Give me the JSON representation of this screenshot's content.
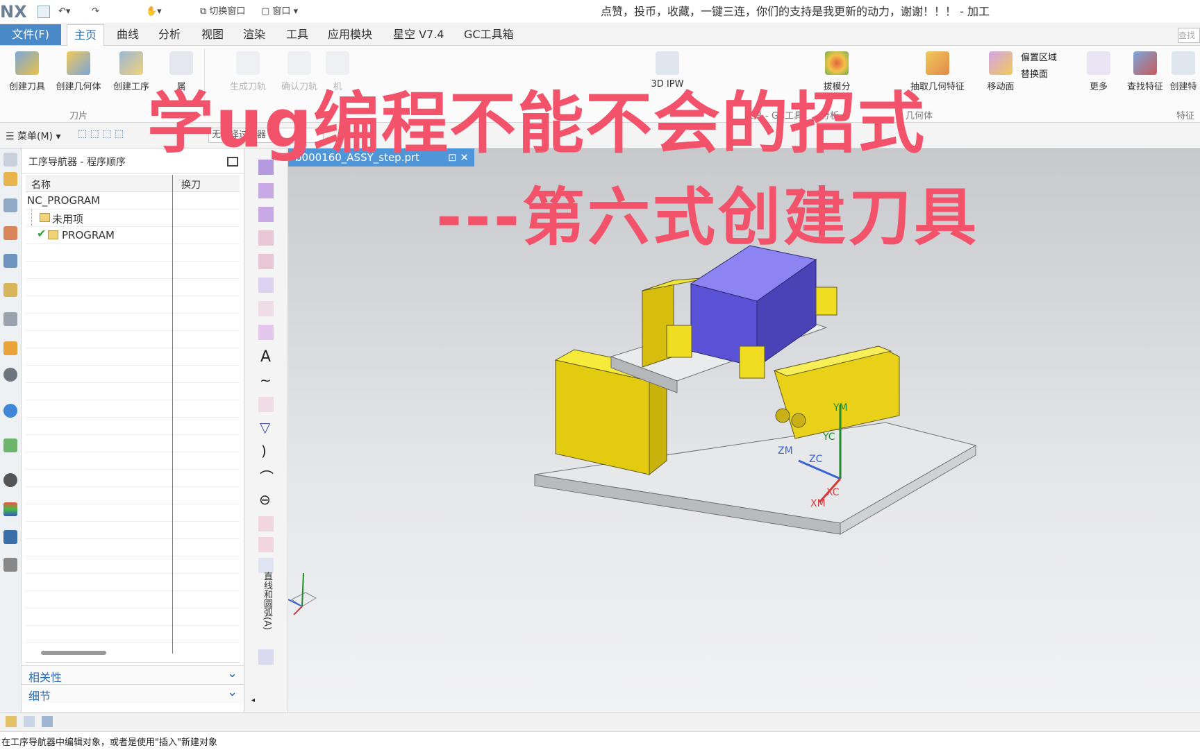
{
  "app": {
    "logo": "NX",
    "title": "点赞，投币，收藏，一键三连，你们的支持是我更新的动力，谢谢！！！ - 加工",
    "quick_access": {
      "switch_window": "切换窗口",
      "window": "窗口"
    }
  },
  "menu_tabs": {
    "file": "文件(F)",
    "items": [
      "主页",
      "曲线",
      "分析",
      "视图",
      "渲染",
      "工具",
      "应用模块",
      "星空 V7.4",
      "GC工具箱"
    ],
    "active": "主页",
    "search_placeholder": "查找"
  },
  "ribbon": {
    "buttons": [
      {
        "label": "创建刀具",
        "icon": "create-tool-icon"
      },
      {
        "label": "创建几何体",
        "icon": "create-geometry-icon"
      },
      {
        "label": "创建工序",
        "icon": "create-operation-icon"
      },
      {
        "label": "属",
        "icon": "properties-icon"
      },
      {
        "label": "生成刀轨",
        "icon": "generate-path-icon"
      },
      {
        "label": "确认刀轨",
        "icon": "verify-path-icon"
      },
      {
        "label": "机",
        "icon": "machine-icon"
      },
      {
        "label": "3D IPW",
        "icon": "ipw-icon"
      },
      {
        "label": "拔模分",
        "icon": "draft-analysis-icon"
      },
      {
        "label": "抽取几何特征",
        "icon": "extract-geometry-icon"
      },
      {
        "label": "移动面",
        "icon": "move-face-icon"
      },
      {
        "label": "偏置区域",
        "icon": "offset-region-icon"
      },
      {
        "label": "替换面",
        "icon": "replace-face-icon"
      },
      {
        "label": "更多",
        "icon": "more-icon"
      },
      {
        "label": "查找特征",
        "icon": "find-feature-icon"
      },
      {
        "label": "创建特",
        "icon": "create-feature-icon"
      }
    ],
    "groups": [
      "刀片",
      "工具 - GC工具",
      "分析",
      "几何体",
      "特征"
    ]
  },
  "command_bar": {
    "menu": "菜单(M)",
    "filter": "无选择过滤器"
  },
  "navigator": {
    "title": "工序导航器 - 程序顺序",
    "columns": [
      "名称",
      "换刀"
    ],
    "rows": [
      {
        "name": "NC_PROGRAM",
        "level": 0,
        "icon": "none"
      },
      {
        "name": "未用项",
        "level": 1,
        "icon": "folder-icon"
      },
      {
        "name": "PROGRAM",
        "level": 1,
        "icon": "folder-check-icon"
      }
    ],
    "panels": [
      "相关性",
      "细节"
    ]
  },
  "vertical_toolbar_label": "直线和圆弧(A)",
  "document_tab": {
    "name": "b000160_ASSY_step.prt"
  },
  "triad": {
    "labels": [
      "YM",
      "YC",
      "ZM",
      "ZC",
      "XC",
      "XM"
    ]
  },
  "overlay": {
    "headline": "学ug编程不能不会的招式",
    "subhead": "---第六式创建刀具"
  },
  "status": {
    "prompt": "在工序导航器中编辑对象，或者是使用\"插入\"新建对象"
  },
  "colors": {
    "accent": "#4a89c8",
    "caption": "#f2536b",
    "part_yellow": "#f4e22b",
    "stock_blue": "#6a61e6"
  }
}
